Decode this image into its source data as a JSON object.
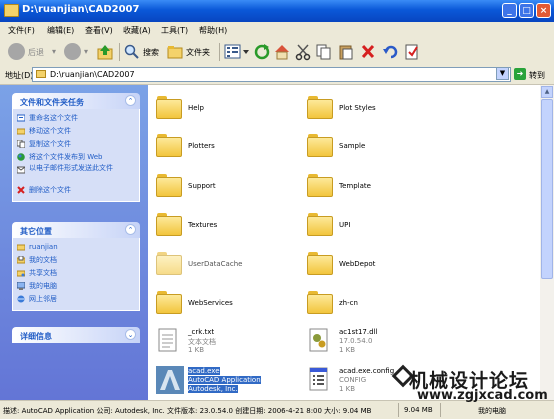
{
  "window": {
    "title": "D:\\ruanjian\\CAD2007"
  },
  "menu": [
    "文件(F)",
    "编辑(E)",
    "查看(V)",
    "收藏(A)",
    "工具(T)",
    "帮助(H)"
  ],
  "toolbar": {
    "back": "后退",
    "search": "搜索",
    "folders": "文件夹"
  },
  "address": {
    "label": "地址(D)",
    "path": "D:\\ruanjian\\CAD2007",
    "go": "转到"
  },
  "tasks": {
    "title": "文件和文件夹任务",
    "items": [
      "重命名这个文件",
      "移动这个文件",
      "复制这个文件",
      "将这个文件发布到 Web",
      "以电子邮件形式发送此文件",
      "删除这个文件"
    ]
  },
  "other_places": {
    "title": "其它位置",
    "items": [
      "ruanjian",
      "我的文档",
      "共享文档",
      "我的电脑",
      "网上邻居"
    ]
  },
  "details": {
    "title": "详细信息"
  },
  "folders": [
    "Help",
    "Plot Styles",
    "Plotters",
    "Sample",
    "Support",
    "Template",
    "Textures",
    "UPI",
    "UserDataCache",
    "WebDepot",
    "WebServices",
    "zh-cn"
  ],
  "files": [
    {
      "name": "_crk.txt",
      "type": "文本文档",
      "size": "1 KB"
    },
    {
      "name": "ac1st17.dll",
      "type": "17.0.54.0",
      "size": "1 KB"
    },
    {
      "name": "acad.exe",
      "type": "AutoCAD Application",
      "size": "Autodesk, Inc."
    },
    {
      "name": "acad.exe.config",
      "type": "CONFIG",
      "size": "1 KB"
    }
  ],
  "status": {
    "text": "描述: AutoCAD Application 公司: Autodesk, Inc. 文件版本: 23.0.54.0 创建日期: 2006-4-21 8:00 大小: 9.04 MB",
    "size": "9.04 MB",
    "zone": "我的电脑"
  },
  "watermark": {
    "cn": "机械设计论坛",
    "url": "www.zgjxcad.com"
  }
}
